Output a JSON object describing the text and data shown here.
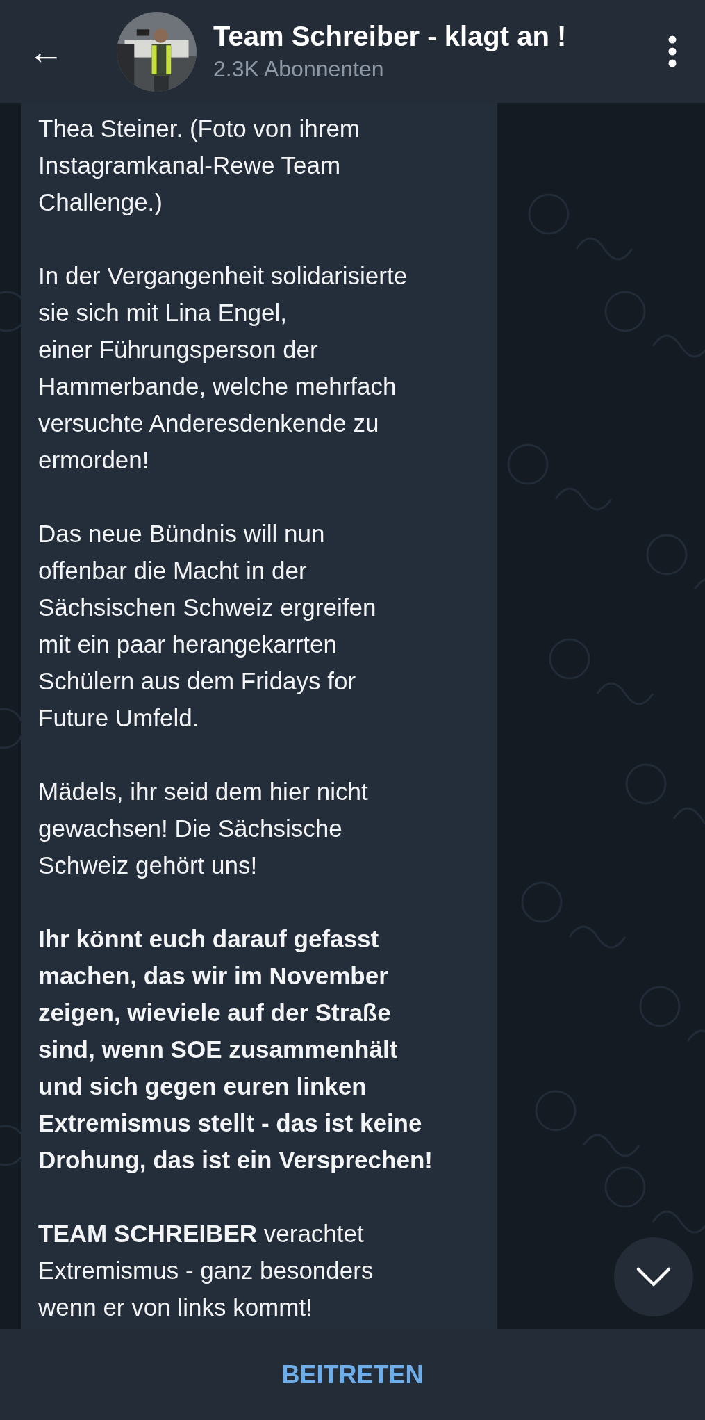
{
  "header": {
    "back": "←",
    "title": "Team Schreiber - klagt an !",
    "subtitle": "2.3K Abonnenten"
  },
  "message": {
    "paragraphs": [
      {
        "text": "Thea Steiner. (Foto von ihrem\nInstagramkanal-Rewe Team\nChallenge.)",
        "bold": false
      },
      {
        "text": "In der Vergangenheit solidarisierte\nsie sich mit Lina Engel,\neiner Führungsperson der\nHammerbande, welche mehrfach\nversuchte Anderesdenkende zu\nermorden!",
        "bold": false
      },
      {
        "text": "Das neue Bündnis will nun\noffenbar die Macht in der\nSächsischen Schweiz ergreifen\nmit ein paar herangekarrten\nSchülern aus dem Fridays for\nFuture Umfeld.",
        "bold": false
      },
      {
        "text": "Mädels, ihr seid dem hier nicht\ngewachsen! Die Sächsische\nSchweiz gehört uns!",
        "bold": false
      },
      {
        "text": "Ihr könnt euch darauf gefasst\nmachen, das wir im November\nzeigen, wieviele auf der Straße\nsind, wenn SOE zusammenhält\nund sich gegen euren linken\nExtremismus stellt - das ist keine\nDrohung, das ist ein Versprechen!",
        "bold": true
      },
      {
        "text": "**TEAM SCHREIBER** verachtet\nExtremismus - ganz besonders\nwenn er von links kommt!",
        "bold": false
      }
    ]
  },
  "join_button": "BEITRETEN"
}
